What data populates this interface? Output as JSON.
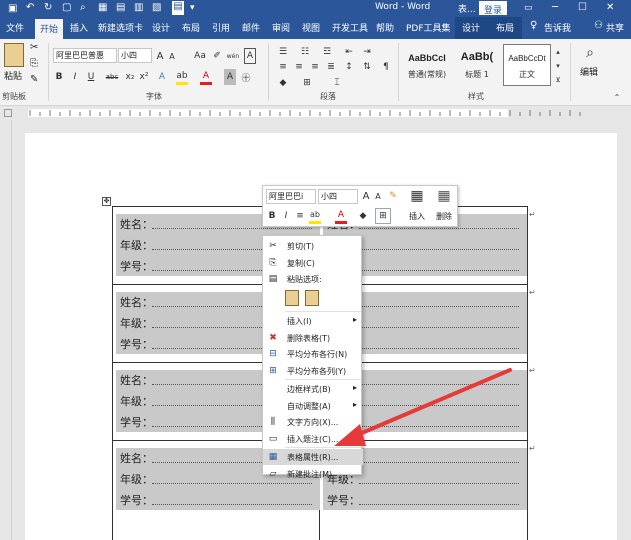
{
  "window": {
    "title": "Word",
    "doc_title": "表...",
    "sep": "-",
    "login_label": "登录"
  },
  "tabs": [
    "文件",
    "开始",
    "插入",
    "新建选项卡",
    "设计",
    "布局",
    "引用",
    "邮件",
    "审阅",
    "视图",
    "开发工具",
    "帮助",
    "PDF工具集"
  ],
  "context_tabs": [
    "设计",
    "布局"
  ],
  "tell_me": "告诉我",
  "share": "共享",
  "ribbon": {
    "clipboard": {
      "paste_label": "粘贴",
      "group": "剪贴板"
    },
    "font": {
      "font_name": "阿里巴巴普惠",
      "font_size": "小四",
      "group": "字体",
      "bold": "B",
      "italic": "I",
      "underline": "U",
      "strike": "abc",
      "sub": "x₂",
      "sup": "x²",
      "font_color": "A",
      "grow": "A",
      "shrink": "A",
      "case": "Aa",
      "phonetic": "wén",
      "border_a": "A"
    },
    "paragraph": {
      "group": "段落"
    },
    "styles": {
      "group": "样式",
      "items": [
        {
          "preview": "AaBbCcI",
          "name": "普通(常规)"
        },
        {
          "preview": "AaBb(",
          "name": "标题 1"
        },
        {
          "preview": "AaBbCcDt",
          "name": "正文"
        }
      ]
    },
    "editing": {
      "label": "编辑"
    }
  },
  "mini_toolbar": {
    "font_name": "阿里巴巴i",
    "font_size": "小四",
    "insert_label": "插入",
    "delete_label": "删除"
  },
  "context_menu": {
    "items": [
      {
        "icon": "scissors-icon",
        "text": "剪切(T)"
      },
      {
        "icon": "copy-icon",
        "text": "复制(C)"
      },
      {
        "icon": "paste-icon",
        "text": "粘贴选项:"
      },
      {
        "icon": "",
        "text": ""
      },
      {
        "icon": "",
        "text": "插入(I)",
        "arrow": "▸"
      },
      {
        "icon": "delete-table-icon",
        "text": "删除表格(T)"
      },
      {
        "icon": "distribute-rows-icon",
        "text": "平均分布各行(N)"
      },
      {
        "icon": "distribute-cols-icon",
        "text": "平均分布各列(Y)"
      },
      {
        "icon": "",
        "text": "边框样式(B)",
        "arrow": "▸"
      },
      {
        "icon": "",
        "text": "自动调整(A)",
        "arrow": "▸"
      },
      {
        "icon": "text-direction-icon",
        "text": "文字方向(X)..."
      },
      {
        "icon": "caption-icon",
        "text": "插入题注(C)..."
      },
      {
        "icon": "table-properties-icon",
        "text": "表格属性(R)..."
      },
      {
        "icon": "new-comment-icon",
        "text": "新建批注(M)"
      }
    ]
  },
  "form": {
    "labels": [
      "姓名：",
      "年级：",
      "学号："
    ]
  },
  "colors": {
    "accent": "#2b579a",
    "arrow": "#e63a3a"
  }
}
